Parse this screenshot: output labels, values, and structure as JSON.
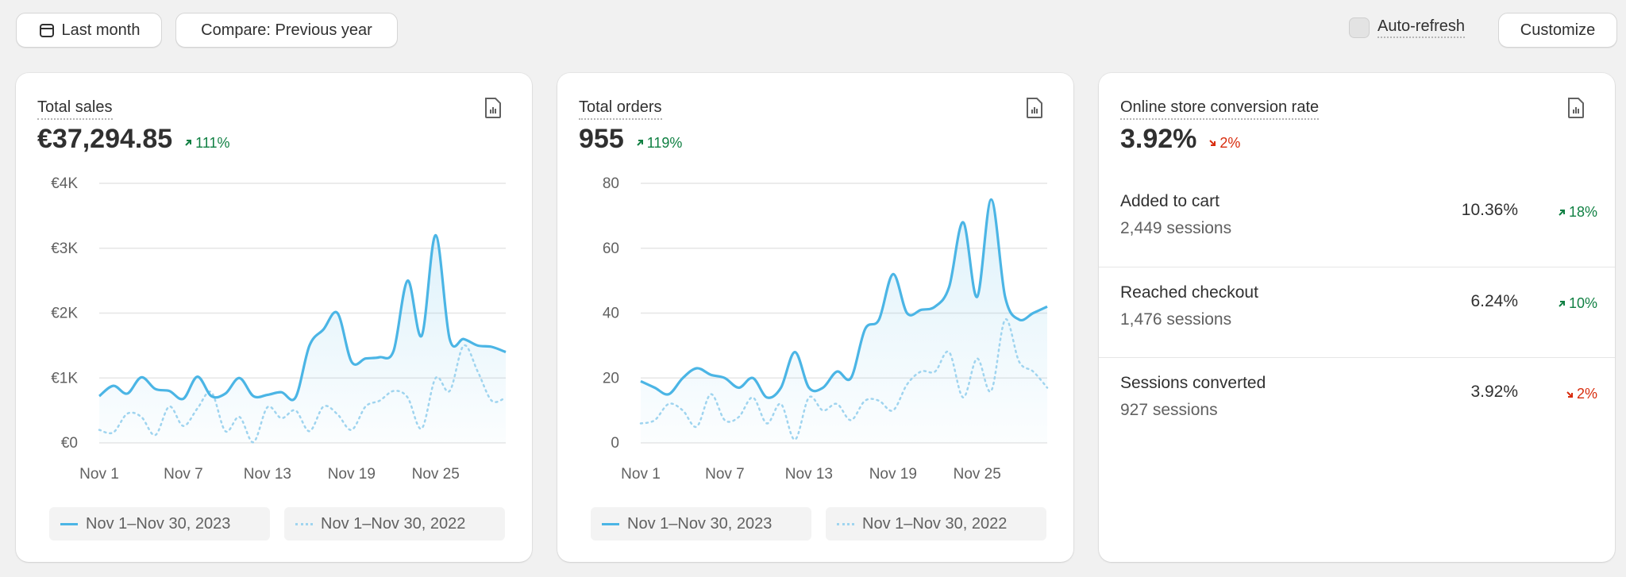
{
  "toolbar": {
    "date_label": "Last month",
    "compare_label": "Compare: Previous year",
    "autorefresh_label": "Auto-refresh",
    "customize_label": "Customize"
  },
  "colors": {
    "current": "#4bb5e5",
    "previous": "#9fd4ef",
    "up": "#108043",
    "down": "#d82c0d"
  },
  "sales": {
    "label": "Total sales",
    "value": "€37,294.85",
    "change": "111%",
    "direction": "up",
    "legend_current": "Nov 1–Nov 30, 2023",
    "legend_previous": "Nov 1–Nov 30, 2022"
  },
  "orders": {
    "label": "Total orders",
    "value": "955",
    "change": "119%",
    "direction": "up",
    "legend_current": "Nov 1–Nov 30, 2023",
    "legend_previous": "Nov 1–Nov 30, 2022"
  },
  "conversion": {
    "label": "Online store conversion rate",
    "value": "3.92%",
    "change": "2%",
    "direction": "down",
    "rows": [
      {
        "label": "Added to cart",
        "sessions": "2,449 sessions",
        "rate": "10.36%",
        "change": "18%",
        "direction": "up"
      },
      {
        "label": "Reached checkout",
        "sessions": "1,476 sessions",
        "rate": "6.24%",
        "change": "10%",
        "direction": "up"
      },
      {
        "label": "Sessions converted",
        "sessions": "927 sessions",
        "rate": "3.92%",
        "change": "2%",
        "direction": "down"
      }
    ]
  },
  "chart_data": [
    {
      "type": "line",
      "title": "Total sales",
      "x_ticks": [
        "Nov 1",
        "Nov 7",
        "Nov 13",
        "Nov 19",
        "Nov 25"
      ],
      "y_ticks": [
        "€0",
        "€1K",
        "€2K",
        "€3K",
        "€4K"
      ],
      "ylim": [
        0,
        4000
      ],
      "grid": true,
      "x": [
        1,
        2,
        3,
        4,
        5,
        6,
        7,
        8,
        9,
        10,
        11,
        12,
        13,
        14,
        15,
        16,
        17,
        18,
        19,
        20,
        21,
        22,
        23,
        24,
        25,
        26,
        27,
        28,
        29,
        30
      ],
      "series": [
        {
          "name": "Nov 1–Nov 30, 2023",
          "style": "solid",
          "values": [
            720,
            880,
            760,
            1010,
            830,
            800,
            680,
            1020,
            720,
            760,
            1000,
            720,
            740,
            780,
            700,
            1500,
            1750,
            2000,
            1250,
            1300,
            1320,
            1420,
            2500,
            1650,
            3200,
            1600,
            1600,
            1500,
            1480,
            1400
          ]
        },
        {
          "name": "Nov 1–Nov 30, 2022",
          "style": "dotted",
          "values": [
            200,
            160,
            450,
            400,
            120,
            560,
            260,
            530,
            780,
            180,
            400,
            10,
            550,
            380,
            500,
            180,
            560,
            440,
            200,
            560,
            650,
            800,
            700,
            220,
            1000,
            800,
            1500,
            1100,
            650,
            700
          ]
        }
      ]
    },
    {
      "type": "line",
      "title": "Total orders",
      "x_ticks": [
        "Nov 1",
        "Nov 7",
        "Nov 13",
        "Nov 19",
        "Nov 25"
      ],
      "y_ticks": [
        "0",
        "20",
        "40",
        "60",
        "80"
      ],
      "ylim": [
        0,
        80
      ],
      "grid": true,
      "x": [
        1,
        2,
        3,
        4,
        5,
        6,
        7,
        8,
        9,
        10,
        11,
        12,
        13,
        14,
        15,
        16,
        17,
        18,
        19,
        20,
        21,
        22,
        23,
        24,
        25,
        26,
        27,
        28,
        29,
        30
      ],
      "series": [
        {
          "name": "Nov 1–Nov 30, 2023",
          "style": "solid",
          "values": [
            19,
            17,
            15,
            20,
            23,
            21,
            20,
            17,
            20,
            14,
            17,
            28,
            17,
            17,
            22,
            20,
            35,
            38,
            52,
            40,
            41,
            42,
            48,
            68,
            45,
            75,
            45,
            38,
            40,
            42
          ]
        },
        {
          "name": "Nov 1–Nov 30, 2022",
          "style": "dotted",
          "values": [
            6,
            7,
            12,
            10,
            5,
            15,
            7,
            8,
            14,
            6,
            12,
            1,
            14,
            10,
            12,
            7,
            13,
            13,
            10,
            18,
            22,
            22,
            28,
            14,
            26,
            16,
            38,
            25,
            22,
            17
          ]
        }
      ]
    }
  ]
}
